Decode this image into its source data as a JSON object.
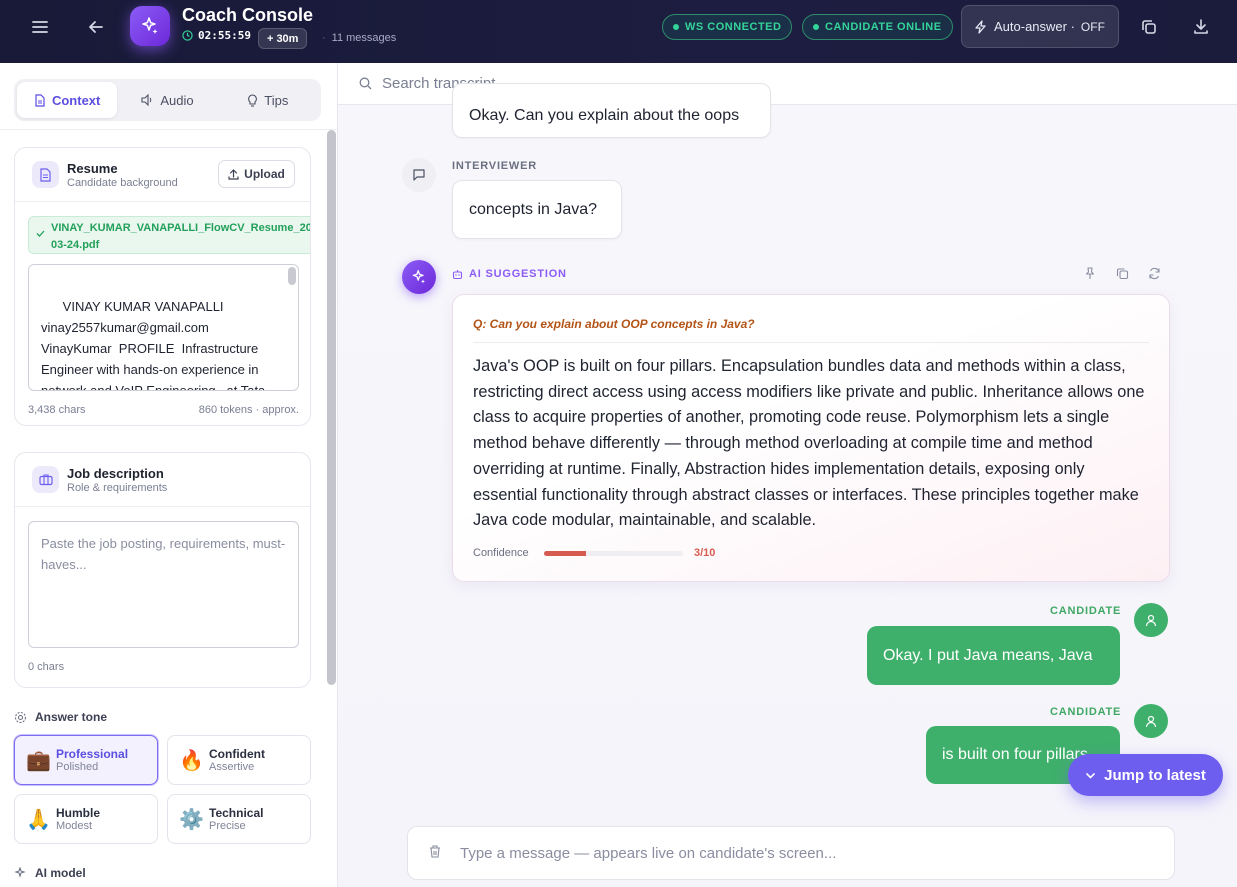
{
  "header": {
    "title": "Coach Console",
    "timer": "02:55:59",
    "extend_label": "30m",
    "message_count": "11 messages",
    "ws_status": "WS CONNECTED",
    "candidate_status": "CANDIDATE ONLINE",
    "auto_answer_label": "Auto-answer ·",
    "auto_answer_state": "OFF"
  },
  "left": {
    "tabs": [
      {
        "label": "Context",
        "icon": "document-icon"
      },
      {
        "label": "Audio",
        "icon": "speaker-icon"
      },
      {
        "label": "Tips",
        "icon": "lightbulb-icon"
      }
    ],
    "resume": {
      "title": "Resume",
      "subtitle": "Candidate background",
      "upload_label": "Upload",
      "file_name_line1": "VINAY_KUMAR_VANAPALLI_FlowCV_Resume_20",
      "file_name_line2": "03-24.pdf",
      "text": "VINAY KUMAR VANAPALLI  vinay2557kumar@gmail.com VinayKumar  PROFILE  Infrastructure Engineer with hands-on experience in network and VoIP Engineering   at Tata Consultancy Services (TCS)",
      "chars": "3,438 chars",
      "tokens": "860 tokens · approx."
    },
    "job": {
      "title": "Job description",
      "subtitle": "Role & requirements",
      "placeholder": "Paste the job posting, requirements, must-haves...",
      "chars": "0 chars"
    },
    "tone_label": "Answer tone",
    "tones": [
      {
        "name": "Professional",
        "sub": "Polished",
        "emoji": "💼"
      },
      {
        "name": "Confident",
        "sub": "Assertive",
        "emoji": "🔥"
      },
      {
        "name": "Humble",
        "sub": "Modest",
        "emoji": "🙏"
      },
      {
        "name": "Technical",
        "sub": "Precise",
        "emoji": "⚙️"
      }
    ],
    "model_label": "AI model"
  },
  "main": {
    "search_placeholder": "Search transcript...",
    "messages": {
      "top_bubble": "Okay. Can you explain about the oops",
      "interviewer_label": "INTERVIEWER",
      "interviewer_bubble": "concepts in Java?",
      "ai_label": "AI SUGGESTION",
      "ai_question": "Q: Can you explain about OOP concepts in Java?",
      "ai_answer": "Java's OOP is built on four pillars. Encapsulation bundles data and methods within a class, restricting direct access using access modifiers like private and public. Inheritance allows one class to acquire properties of another, promoting code reuse. Polymorphism lets a single method behave differently — through method overloading at compile time and method overriding at runtime. Finally, Abstraction hides implementation details, exposing only essential functionality through abstract classes or interfaces. These principles together make Java code modular, maintainable, and scalable.",
      "confidence_label": "Confidence",
      "confidence_score": "3/10",
      "confidence_value": 0.3,
      "candidate_label_1": "CANDIDATE",
      "candidate_bubble_1": "Okay. I put Java means, Java",
      "candidate_label_2": "CANDIDATE",
      "candidate_bubble_2": "is built on four pillars"
    },
    "jump_label": "Jump to latest",
    "composer_placeholder": "Type a message — appears live on candidate's screen..."
  },
  "colors": {
    "accent": "#6d5ef0",
    "candidate": "#3fb06b",
    "status_green": "#34d399",
    "confidence": "#d65c52"
  }
}
